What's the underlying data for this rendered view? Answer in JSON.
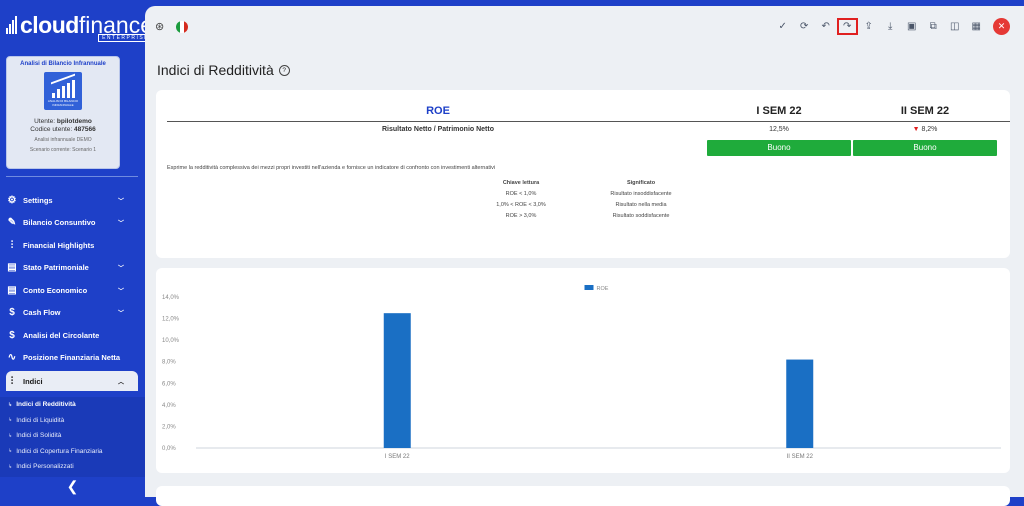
{
  "sidebar": {
    "logo": {
      "cloud": "cloud",
      "finance": "finance",
      "enterprise": "ENTERPRISE"
    },
    "card": {
      "title": "Analisi di Bilancio Infrannuale",
      "icon_caption": "ANALISI DI BILANCIO INFRANNUALE",
      "user_label": "Utente:",
      "user": "bpilotdemo",
      "code_label": "Codice utente:",
      "code": "487566",
      "analysis": "Analisi infrannuale DEMO",
      "scenario": "Scenario corrente: Scenario 1"
    },
    "menu": [
      {
        "label": "Settings",
        "icon": "gear-icon",
        "chevron": true
      },
      {
        "label": "Bilancio Consuntivo",
        "icon": "edit-icon",
        "chevron": true
      },
      {
        "label": "Financial Highlights",
        "icon": "bar-chart-icon",
        "chevron": false
      },
      {
        "label": "Stato Patrimoniale",
        "icon": "document-icon",
        "chevron": true
      },
      {
        "label": "Conto Economico",
        "icon": "document-icon",
        "chevron": true
      },
      {
        "label": "Cash Flow",
        "icon": "dollar-icon",
        "chevron": true
      },
      {
        "label": "Analisi del Circolante",
        "icon": "dollar-icon",
        "chevron": false
      },
      {
        "label": "Posizione Finanziaria Netta",
        "icon": "pulse-icon",
        "chevron": false
      },
      {
        "label": "Indici",
        "icon": "bar-chart-icon",
        "chevron": true,
        "active": true
      }
    ],
    "submenu": [
      {
        "label": "Indici di Redditività",
        "active": true
      },
      {
        "label": "Indici di Liquidità"
      },
      {
        "label": "Indici di Solidità"
      },
      {
        "label": "Indici di Copertura Finanziaria"
      },
      {
        "label": "Indici Personalizzati"
      }
    ],
    "collapse_glyph": "❮"
  },
  "toolbar": {
    "icons": [
      "check-icon",
      "refresh-icon",
      "undo-icon",
      "redo-icon",
      "upload-icon",
      "download-icon",
      "save-icon",
      "copy-icon",
      "columns-icon",
      "layout-icon"
    ],
    "highlighted": "redo-icon"
  },
  "page": {
    "title": "Indici di Redditività"
  },
  "roe": {
    "name": "ROE",
    "formula": "Risultato Netto / Patrimonio Netto",
    "col1": {
      "header": "I SEM 22",
      "value": "12,5%",
      "rating": "Buono"
    },
    "col2": {
      "header": "II SEM 22",
      "value": "8,2%",
      "rating": "Buono",
      "trend": "▼"
    },
    "description": "Esprime la redditività complessiva dei mezzi propri investiti nell'azienda e fornisce un indicatore di confronto con investimenti alternativi",
    "legend_key_header": "Chiave lettura",
    "legend_meaning_header": "Significato",
    "legend_rows": [
      {
        "key": "ROE < 1,0%",
        "meaning": "Risultato insoddisfacente"
      },
      {
        "key": "1,0% < ROE < 3,0%",
        "meaning": "Risultato nella media"
      },
      {
        "key": "ROE > 3,0%",
        "meaning": "Risultato soddisfacente"
      }
    ]
  },
  "colors": {
    "brand": "#1e40c8",
    "good": "#1fab3b",
    "bar": "#1a6fc4",
    "down": "#e02020"
  },
  "chart_data": {
    "type": "bar",
    "categories": [
      "I SEM 22",
      "II SEM 22"
    ],
    "series": [
      {
        "name": "ROE",
        "values": [
          12.5,
          8.2
        ]
      }
    ],
    "yticks": [
      "0,0%",
      "2,0%",
      "4,0%",
      "6,0%",
      "8,0%",
      "10,0%",
      "12,0%",
      "14,0%"
    ],
    "ylim": [
      0,
      14
    ],
    "legend": "top-center",
    "grid": false
  }
}
